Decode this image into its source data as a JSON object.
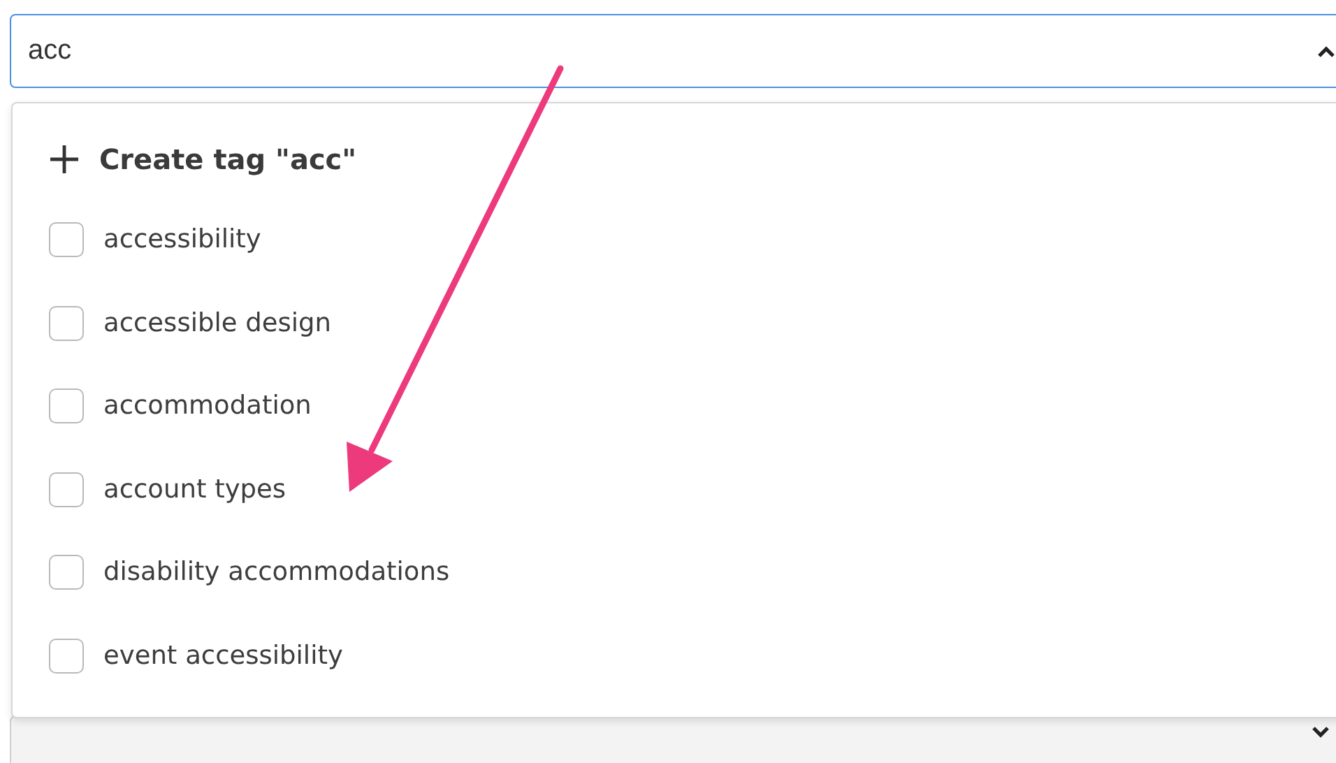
{
  "tag_select": {
    "value": "acc",
    "expanded": true
  },
  "create_option": {
    "label": "Create tag \"acc\""
  },
  "options": [
    {
      "label": "accessibility",
      "checked": false
    },
    {
      "label": "accessible design",
      "checked": false
    },
    {
      "label": "accommodation",
      "checked": false
    },
    {
      "label": "account types",
      "checked": false
    },
    {
      "label": "disability accommodations",
      "checked": false
    },
    {
      "label": "event accessibility",
      "checked": false
    }
  ],
  "next_select": {
    "expanded": false
  }
}
